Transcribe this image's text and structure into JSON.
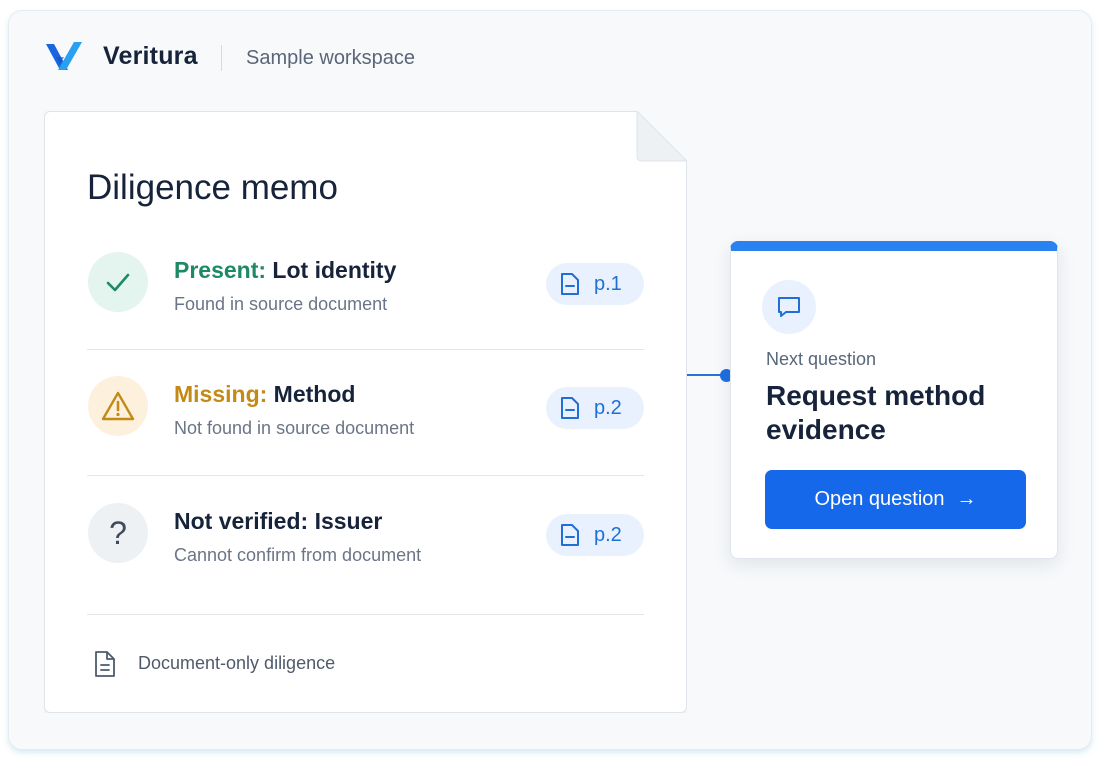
{
  "header": {
    "brand": "Veritura",
    "workspace": "Sample workspace"
  },
  "memo": {
    "title": "Diligence memo",
    "items": [
      {
        "status": "Present:",
        "subject": " Lot identity",
        "detail": "Found in source document",
        "page": "p.1",
        "icon": "check-icon"
      },
      {
        "status": "Missing:",
        "subject": " Method",
        "detail": "Not found in source document",
        "page": "p.2",
        "icon": "warning-icon"
      },
      {
        "status": "",
        "subject": "Not verified: Issuer",
        "detail": "Cannot confirm from document",
        "page": "p.2",
        "icon": "question-icon",
        "glyph": "?"
      }
    ],
    "footer": "Document-only diligence"
  },
  "card": {
    "label": "Next question",
    "title": "Request method evidence",
    "button": "Open question",
    "button_arrow": "→"
  },
  "colors": {
    "accent": "#1668eb",
    "present": "#1d8a63",
    "missing": "#c48a16",
    "text": "#16233a"
  }
}
